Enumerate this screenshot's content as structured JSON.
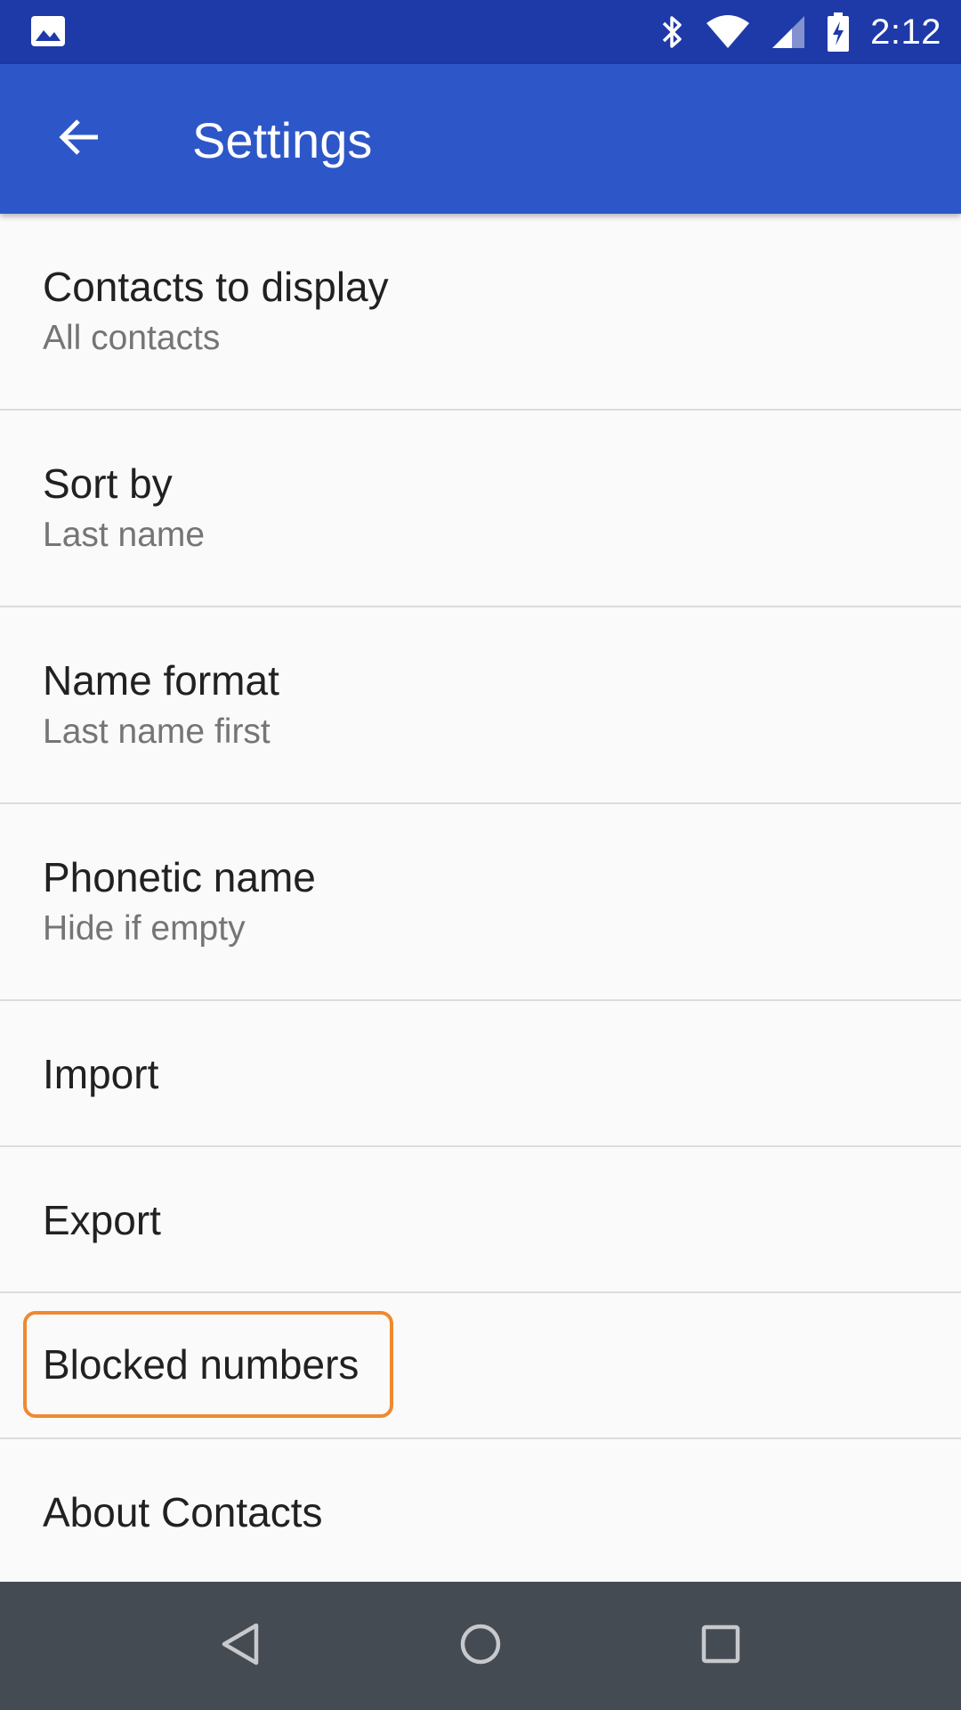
{
  "status_bar": {
    "time": "2:12",
    "icons": [
      "image-icon",
      "bluetooth-icon",
      "wifi-icon",
      "signal-icon",
      "battery-charging-icon"
    ]
  },
  "app_bar": {
    "title": "Settings",
    "back_icon": "arrow-back-icon"
  },
  "settings": {
    "items": [
      {
        "title": "Contacts to display",
        "subtitle": "All contacts"
      },
      {
        "title": "Sort by",
        "subtitle": "Last name"
      },
      {
        "title": "Name format",
        "subtitle": "Last name first"
      },
      {
        "title": "Phonetic name",
        "subtitle": "Hide if empty"
      },
      {
        "title": "Import"
      },
      {
        "title": "Export"
      },
      {
        "title": "Blocked numbers"
      },
      {
        "title": "About Contacts"
      }
    ]
  },
  "nav_bar": {
    "icons": [
      "back-triangle-icon",
      "home-circle-icon",
      "recents-square-icon"
    ]
  },
  "colors": {
    "status_bar": "#1e3aa8",
    "app_bar": "#2d57c8",
    "highlight": "#f0892f",
    "nav_bar": "#454b52"
  }
}
